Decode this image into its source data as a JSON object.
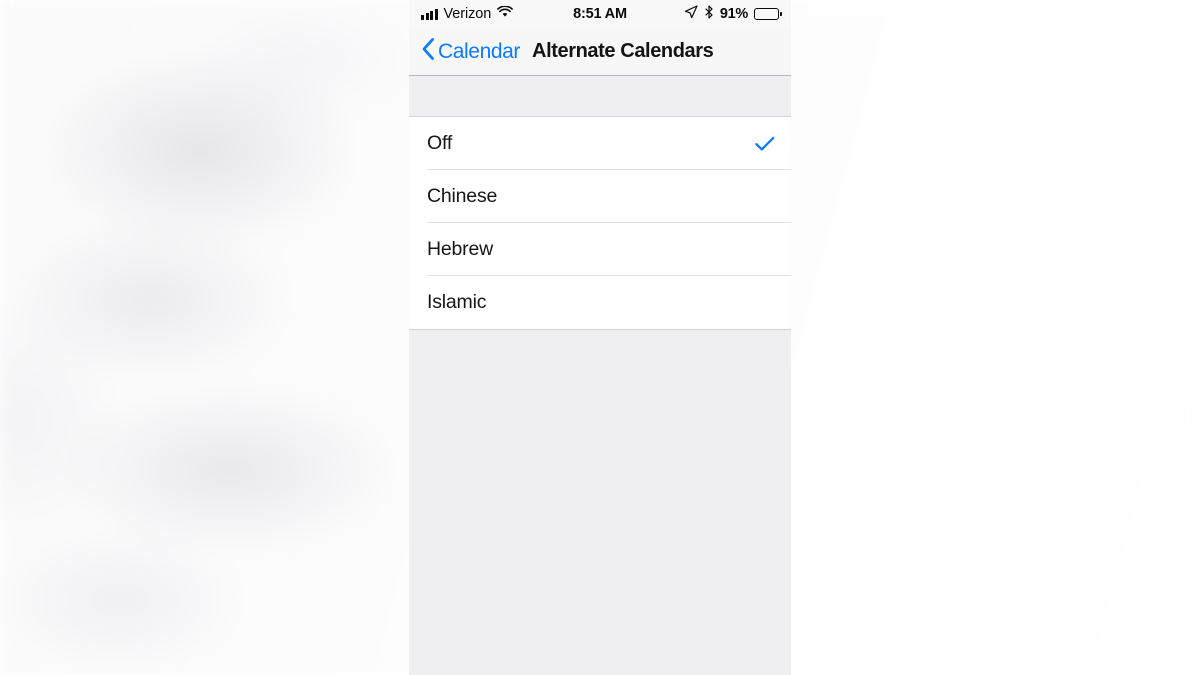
{
  "status_bar": {
    "carrier": "Verizon",
    "signal_icon": "signal-bars-icon",
    "wifi_icon": "wifi-icon",
    "time": "8:51 AM",
    "location_icon": "location-arrow-icon",
    "bluetooth_icon": "bluetooth-icon",
    "battery_percent": "91%",
    "battery_icon": "battery-full-icon"
  },
  "nav": {
    "back_icon": "chevron-left-icon",
    "back_label": "Calendar",
    "title": "Alternate Calendars"
  },
  "list": {
    "options": [
      {
        "label": "Off",
        "selected": true
      },
      {
        "label": "Chinese",
        "selected": false
      },
      {
        "label": "Hebrew",
        "selected": false
      },
      {
        "label": "Islamic",
        "selected": false
      }
    ],
    "check_icon": "checkmark-icon"
  },
  "colors": {
    "accent_blue": "#0a7cff",
    "nav_bar_bg": "#f7f7f7",
    "group_bg": "#efeef3",
    "row_bg": "#ffffff",
    "separator": "#e2e2e5",
    "text_primary": "#161616"
  }
}
